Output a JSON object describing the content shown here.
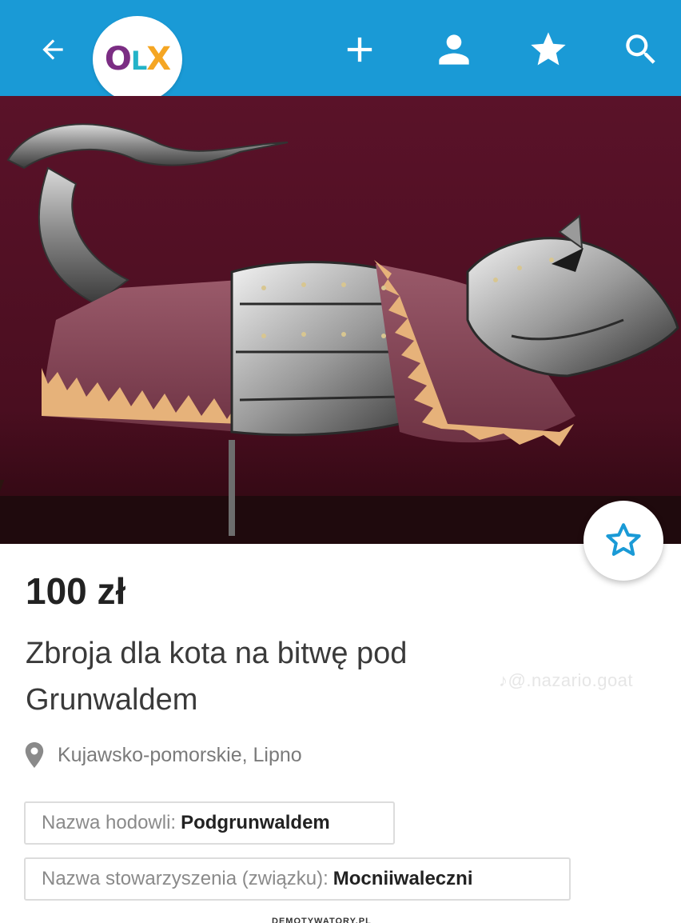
{
  "app": {
    "brand": "OLX",
    "colors": {
      "topbar": "#1a9ad6",
      "logo_o": "#7b2d83",
      "logo_l": "#23b3c8",
      "logo_x": "#f5a623",
      "favorite_star": "#1a9ad6"
    }
  },
  "topbar": {
    "back_icon": "arrow-left-icon",
    "logo": {
      "o": "O",
      "l": "L",
      "x": "X"
    },
    "actions": [
      {
        "icon": "plus-icon"
      },
      {
        "icon": "user-icon"
      },
      {
        "icon": "star-icon"
      },
      {
        "icon": "search-icon"
      }
    ]
  },
  "listing": {
    "price": "100 zł",
    "title": "Zbroja dla kota na bitwę pod Grunwaldem",
    "location": "Kujawsko-pomorskie, Lipno",
    "location_icon": "map-pin-icon",
    "favorite_icon": "star-outline-icon",
    "params": [
      {
        "label": "Nazwa hodowli:",
        "value": "Podgrunwaldem"
      },
      {
        "label": "Nazwa stowarzyszenia (związku):",
        "value": "Mocniiwaleczni"
      }
    ]
  },
  "watermark": "♪@.nazario.goat",
  "footer_cut": "DEMOTYWATORY.PL"
}
